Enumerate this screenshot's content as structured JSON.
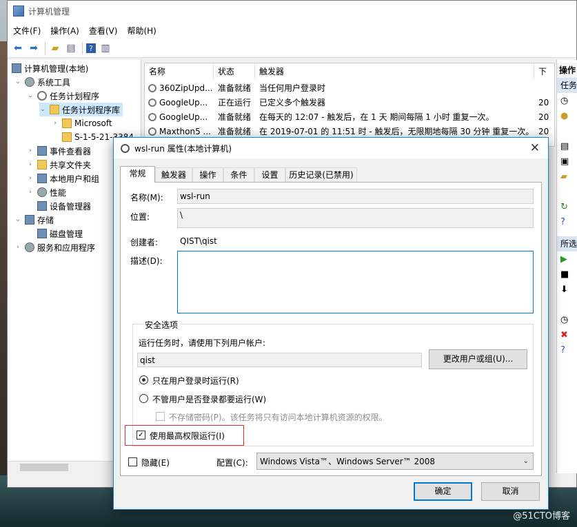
{
  "watermark": "@51CTO博客",
  "mmc": {
    "title": "计算机管理",
    "menu": [
      "文件(F)",
      "操作(A)",
      "查看(V)",
      "帮助(H)"
    ],
    "tree": {
      "root": "计算机管理(本地)",
      "system_tools": "系统工具",
      "task_scheduler": "任务计划程序",
      "task_library": "任务计划程序库",
      "microsoft": "Microsoft",
      "sid_folder": "S-1-5-21-3384",
      "event_viewer": "事件查看器",
      "shared_folders": "共享文件夹",
      "local_users": "本地用户和组",
      "performance": "性能",
      "device_manager": "设备管理器",
      "storage": "存储",
      "disk_management": "磁盘管理",
      "services_apps": "服务和应用程序"
    },
    "list": {
      "headers": [
        "名称",
        "状态",
        "触发器",
        "下"
      ],
      "rows": [
        {
          "name": "360ZipUpd...",
          "status": "准备就绪",
          "trigger": "当任何用户登录时",
          "next": ""
        },
        {
          "name": "GoogleUp...",
          "status": "正在运行",
          "trigger": "已定义多个触发器",
          "next": "20"
        },
        {
          "name": "GoogleUp...",
          "status": "准备就绪",
          "trigger": "在每天的 12:07 - 触发后，在 1 天 期间每隔 1 小时 重复一次。",
          "next": "20"
        },
        {
          "name": "Maxthon5 ...",
          "status": "准备就绪",
          "trigger": "在 2019-07-01 的 11:51 时 - 触发后，无限期地每隔 30 分钟 重复一次。",
          "next": "20"
        }
      ]
    },
    "actions": {
      "header": "操作",
      "section1": "任务",
      "section2": "所选"
    }
  },
  "dialog": {
    "title": "wsl-run 属性(本地计算机)",
    "tabs": [
      "常规",
      "触发器",
      "操作",
      "条件",
      "设置",
      "历史记录(已禁用)"
    ],
    "name_label": "名称(M):",
    "name_value": "wsl-run",
    "location_label": "位置:",
    "location_value": "\\",
    "author_label": "创建者:",
    "author_value": "QIST\\qist",
    "desc_label": "描述(D):",
    "security": {
      "title": "安全选项",
      "run_as_label": "运行任务时，请使用下列用户帐户:",
      "user": "qist",
      "change_button": "更改用户或组(U)...",
      "radio_logged_on": "只在用户登录时运行(R)",
      "radio_always": "不管用户是否登录都要运行(W)",
      "no_store_password": "不存储密码(P)。该任务将只有访问本地计算机资源的权限。",
      "highest_privileges": "使用最高权限运行(I)"
    },
    "hidden_label": "隐藏(E)",
    "configure_label": "配置(C):",
    "configure_value": "Windows Vista™、Windows Server™ 2008",
    "ok": "确定",
    "cancel": "取消"
  }
}
